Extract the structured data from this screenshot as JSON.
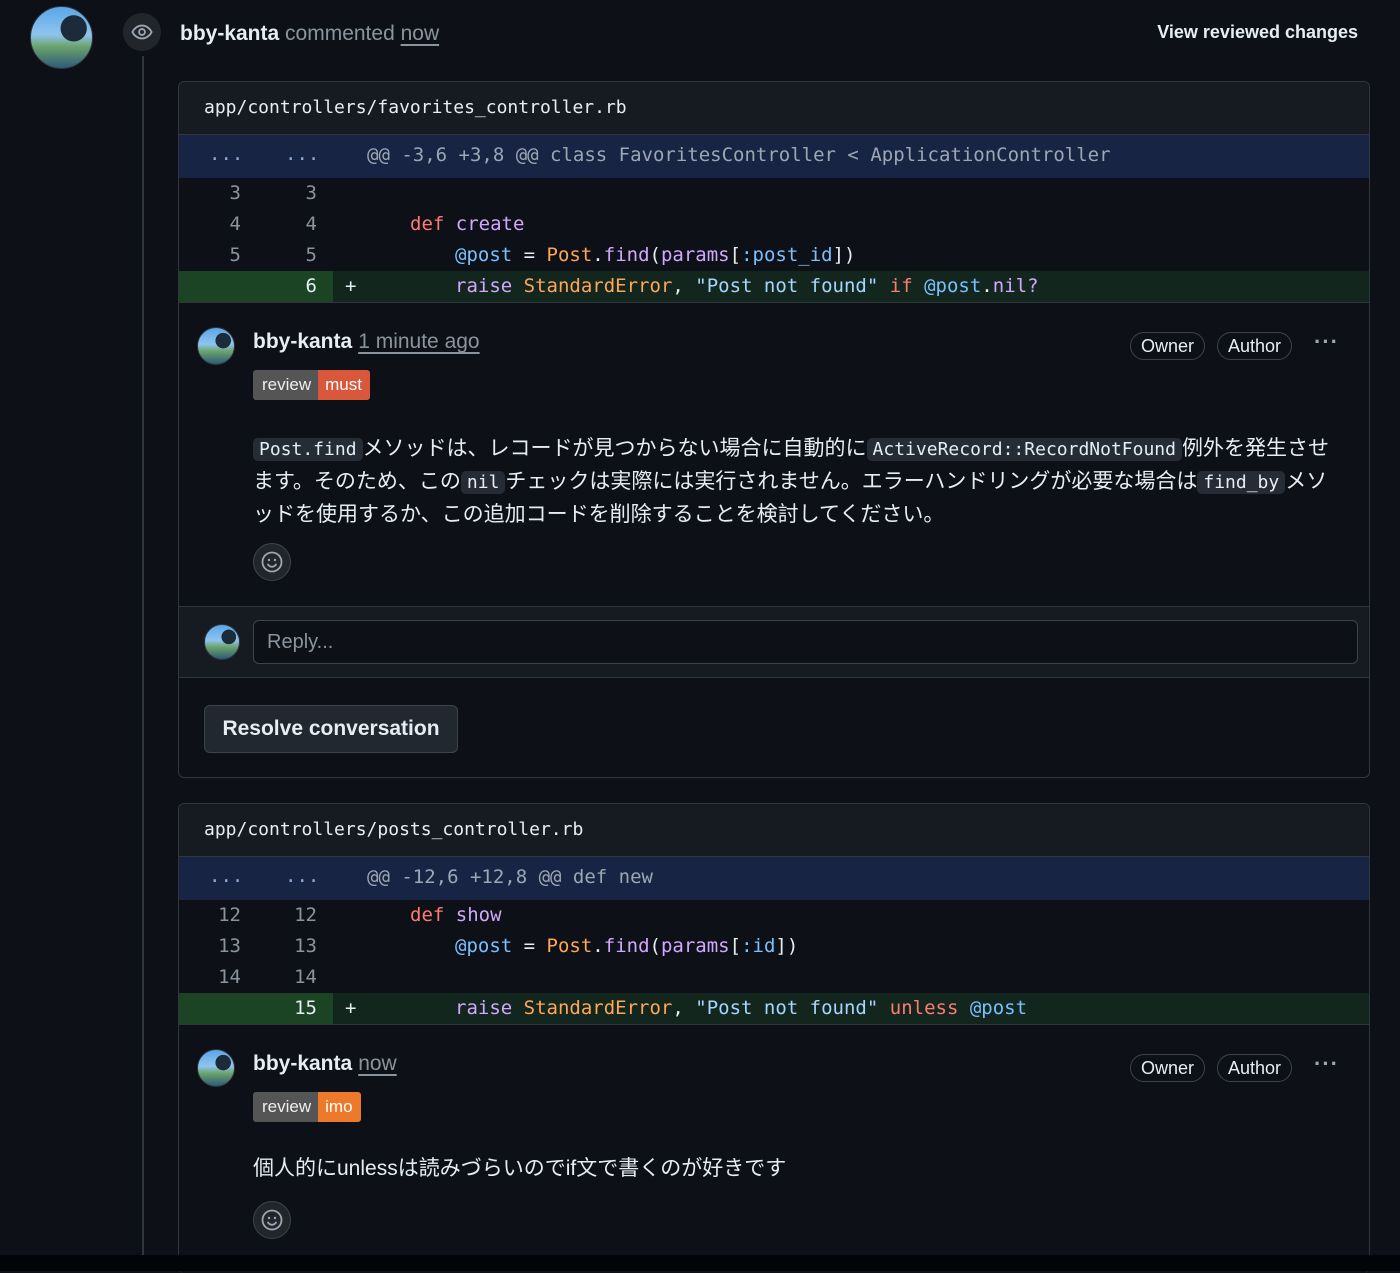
{
  "timeline": {
    "author": "bby-kanta",
    "action": "commented",
    "time": "now",
    "view_changes": "View reviewed changes"
  },
  "threads": [
    {
      "file": "app/controllers/favorites_controller.rb",
      "hunk": {
        "dots_left": "...",
        "dots_right": "...",
        "header": "@@ -3,6 +3,8 @@ class FavoritesController < ApplicationController"
      },
      "lines": [
        {
          "old": "3",
          "new": "3"
        },
        {
          "old": "4",
          "new": "4"
        },
        {
          "old": "5",
          "new": "5"
        },
        {
          "old": "",
          "new": "6",
          "sign": "+"
        }
      ],
      "code_tokens": {
        "l2_kw": "def",
        "l2_fn": "create",
        "l3_var": "@post",
        "l3_eq": " = ",
        "l3_cls": "Post",
        "l3_dot": ".",
        "l3_fn": "find",
        "l3_p1": "(",
        "l3_params": "params",
        "l3_br": "[",
        "l3_sym": ":post_id",
        "l3_end": "])",
        "l4_fn": "raise",
        "l4_cls": "StandardError",
        "l4_comma": ", ",
        "l4_str": "\"Post not found\"",
        "l4_kw": "if",
        "l4_var": "@post",
        "l4_dot": ".",
        "l4_fn2": "nil?"
      },
      "comment": {
        "author": "bby-kanta",
        "time": "1 minute ago",
        "badges": [
          "Owner",
          "Author"
        ],
        "menu": "···",
        "label_left": "review",
        "label_right": "must",
        "label_color": "#d9573b",
        "body": {
          "code1": "Post.find",
          "t1": "メソッドは、レコードが見つからない場合に自動的に",
          "code2": "ActiveRecord::RecordNotFound",
          "t2": "例外を発生させます。そのため、この",
          "code3": "nil",
          "t3": "チェックは実際には実行されません。エラーハンドリングが必要な場合は",
          "code4": "find_by",
          "t4": "メソッドを使用するか、この追加コードを削除することを検討してください。"
        }
      },
      "reply_placeholder": "Reply...",
      "resolve": "Resolve conversation"
    },
    {
      "file": "app/controllers/posts_controller.rb",
      "hunk": {
        "dots_left": "...",
        "dots_right": "...",
        "header": "@@ -12,6 +12,8 @@ def new"
      },
      "lines": [
        {
          "old": "12",
          "new": "12"
        },
        {
          "old": "13",
          "new": "13"
        },
        {
          "old": "14",
          "new": "14"
        },
        {
          "old": "",
          "new": "15",
          "sign": "+"
        }
      ],
      "code_tokens": {
        "l1_kw": "def",
        "l1_fn": "show",
        "l2_var": "@post",
        "l2_eq": " = ",
        "l2_cls": "Post",
        "l2_dot": ".",
        "l2_fn": "find",
        "l2_p1": "(",
        "l2_params": "params",
        "l2_br": "[",
        "l2_sym": ":id",
        "l2_end": "])",
        "l4_fn": "raise",
        "l4_cls": "StandardError",
        "l4_comma": ", ",
        "l4_str": "\"Post not found\"",
        "l4_kw": "unless",
        "l4_var": "@post"
      },
      "comment": {
        "author": "bby-kanta",
        "time": "now",
        "badges": [
          "Owner",
          "Author"
        ],
        "menu": "···",
        "label_left": "review",
        "label_right": "imo",
        "label_color": "#ec7a2a",
        "body": "個人的にunlessは読みづらいのでif文で書くのが好きです"
      }
    }
  ]
}
